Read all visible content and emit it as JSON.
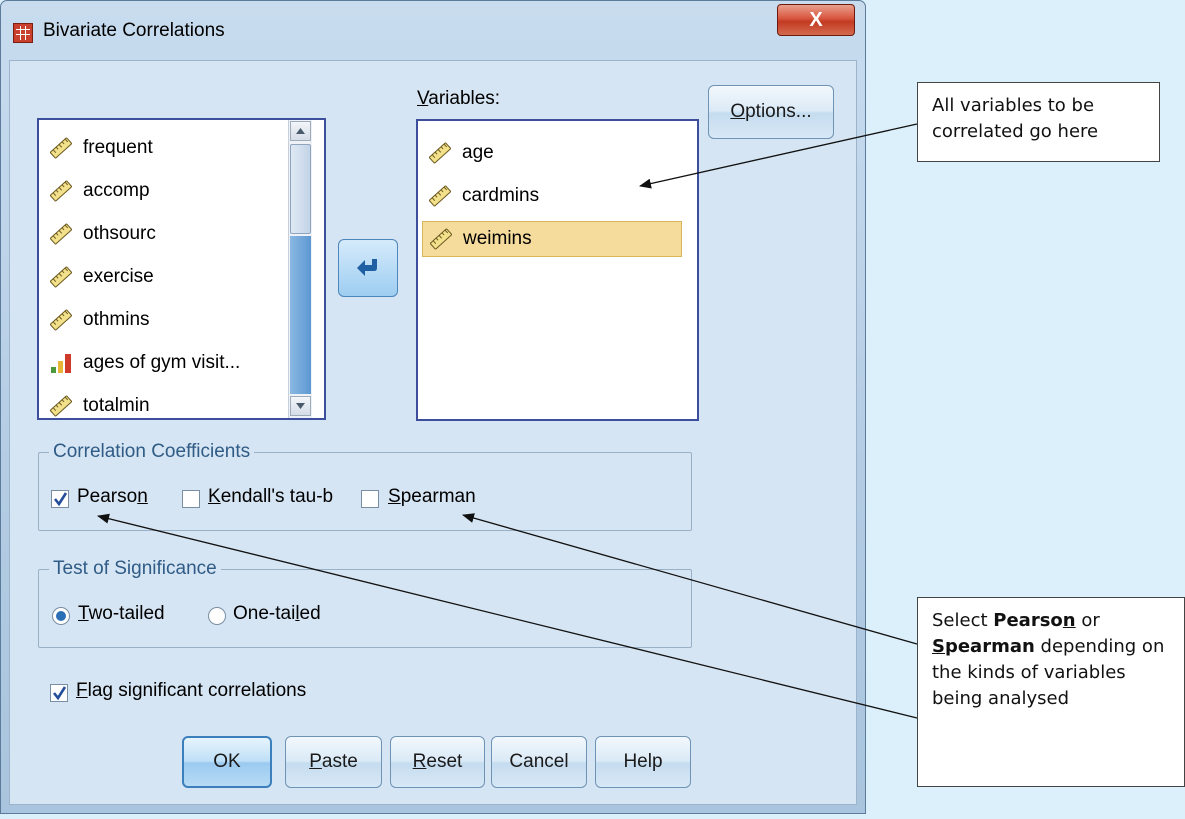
{
  "window": {
    "title": "Bivariate Correlations",
    "close_glyph": "X"
  },
  "source_list": {
    "items": [
      {
        "label": "frequent",
        "icon": "scale-ruler-icon"
      },
      {
        "label": "accomp",
        "icon": "scale-ruler-icon"
      },
      {
        "label": "othsourc",
        "icon": "scale-ruler-icon"
      },
      {
        "label": "exercise",
        "icon": "scale-ruler-icon"
      },
      {
        "label": "othmins",
        "icon": "scale-ruler-icon"
      },
      {
        "label": "ages of gym visit...",
        "icon": "ordinal-bar-icon"
      },
      {
        "label": "totalmin",
        "icon": "scale-ruler-icon"
      }
    ]
  },
  "variables": {
    "label_accel": "V",
    "label_rest": "ariables:",
    "items": [
      {
        "label": "age",
        "icon": "scale-ruler-icon",
        "selected": false
      },
      {
        "label": "cardmins",
        "icon": "scale-ruler-icon",
        "selected": false
      },
      {
        "label": "weimins",
        "icon": "scale-ruler-icon",
        "selected": true
      }
    ]
  },
  "options_button": {
    "accel": "O",
    "rest": "ptions..."
  },
  "correlation_coefficients": {
    "title": "Correlation Coefficients",
    "pearson": {
      "pre": "Pearso",
      "accel": "n",
      "post": "",
      "checked": true
    },
    "kendall": {
      "pre": "",
      "accel": "K",
      "post": "endall's tau-b",
      "checked": false
    },
    "spearman": {
      "pre": "",
      "accel": "S",
      "post": "pearman",
      "checked": false
    }
  },
  "test_of_significance": {
    "title": "Test of Significance",
    "two_tailed": {
      "pre": "",
      "accel": "T",
      "post": "wo-tailed",
      "selected": true
    },
    "one_tailed": {
      "pre": "One-tai",
      "accel": "l",
      "post": "ed",
      "selected": false
    }
  },
  "flag": {
    "accel": "F",
    "rest": "lag significant correlations",
    "checked": true
  },
  "buttons": {
    "ok": "OK",
    "paste": {
      "accel": "P",
      "rest": "aste"
    },
    "reset": {
      "accel": "R",
      "rest": "eset"
    },
    "cancel": "Cancel",
    "help": "Help"
  },
  "callouts": {
    "variables_note": "All variables to be correlated go here",
    "select_note": {
      "t1": "Select ",
      "pearson_pre": "Pearso",
      "pearson_accel": "n",
      "t2": " or ",
      "spearman_accel": "S",
      "spearman_rest": "pearman",
      "t3": " depending on the kinds of variables being analysed"
    }
  },
  "colors": {
    "list_border": "#3d4f9c",
    "selection": "#f6dc9c",
    "group_title": "#2f5b86",
    "background": "#dcf0fb"
  }
}
